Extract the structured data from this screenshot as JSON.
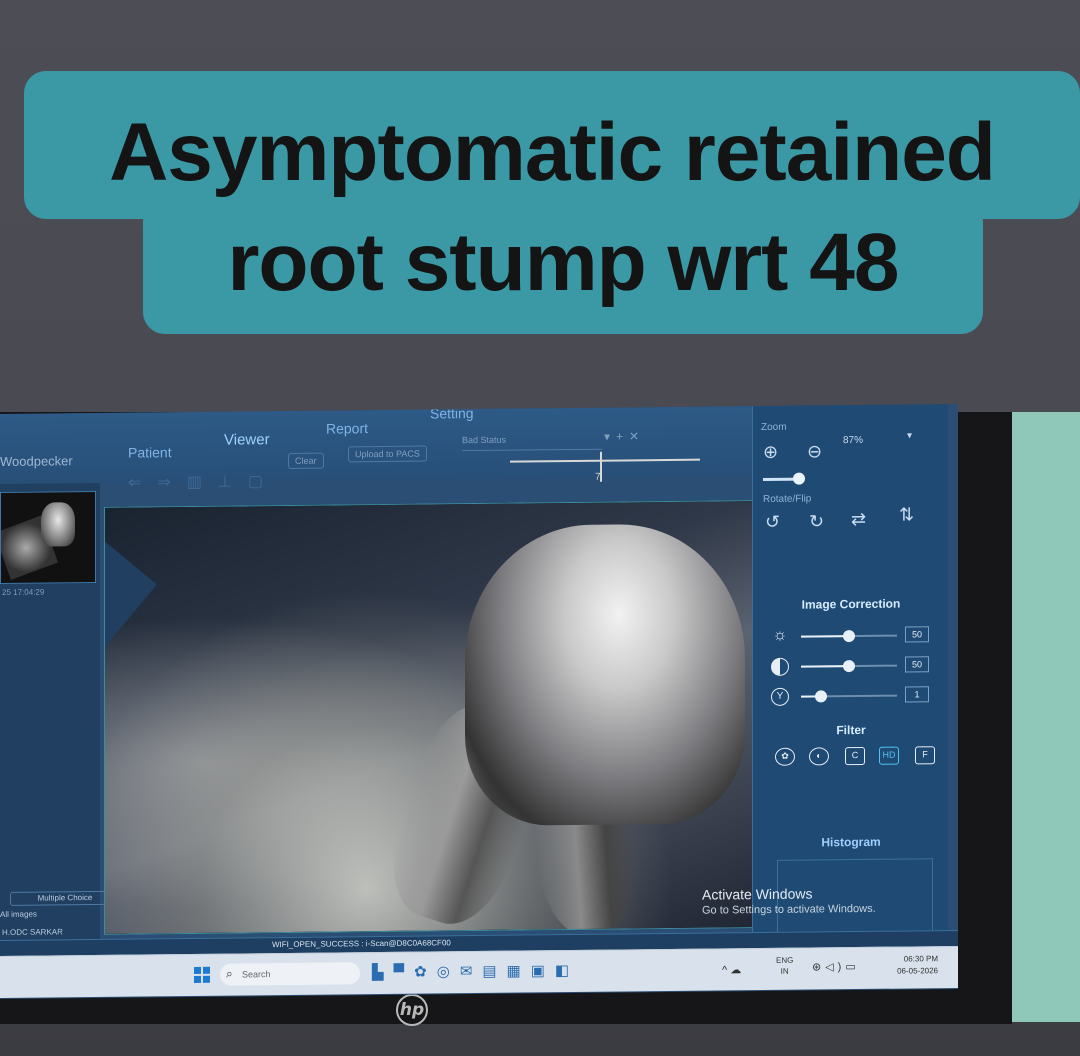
{
  "caption": {
    "line1": "Asymptomatic retained",
    "line2": "root stump wrt 48"
  },
  "app": {
    "title": "Woodpecker",
    "tabs": [
      "Patient",
      "Viewer",
      "Report",
      "Setting"
    ],
    "active_tab": "Viewer",
    "toolbar": {
      "clear_label": "Clear",
      "upload_label": "Upload to PACS",
      "status_label": "Bad Status"
    },
    "sidebar": {
      "thumbnail_date": "25 17:04:29",
      "multiple_choice_label": "Multiple Choice",
      "images_label": "All images",
      "doctor_label": "H.ODC SARKAR"
    },
    "viewer": {
      "slider_value": "7"
    },
    "right_panel": {
      "zoom_label": "Zoom",
      "zoom_value": "87%",
      "rotate_label": "Rotate/Flip",
      "image_correction_label": "Image Correction",
      "brightness": {
        "icon": "sun-icon",
        "value": "50",
        "level": 0.5
      },
      "contrast": {
        "icon": "contrast-icon",
        "value": "50",
        "level": 0.5
      },
      "gamma": {
        "icon": "gamma-icon",
        "value": "1",
        "level": 0.2
      },
      "filter_label": "Filter",
      "filters": [
        "palette",
        "sharpen",
        "C",
        "HD",
        "F"
      ],
      "selected_filter": "HD",
      "histogram_label": "Histogram"
    },
    "watermark": {
      "line1": "Activate Windows",
      "line2": "Go to Settings to activate Windows."
    },
    "status_bar": "WIFI_OPEN_SUCCESS : i-Scan@D8C0A68CF00"
  },
  "taskbar": {
    "search_placeholder": "Search",
    "lang_line1": "ENG",
    "lang_line2": "IN",
    "time": "06:30 PM",
    "date": "06-05-2026"
  },
  "monitor_brand": "hp",
  "colors": {
    "caption_bg": "#3b99a6",
    "app_bg": "#2a4e74",
    "accent": "#4fc3f7"
  }
}
